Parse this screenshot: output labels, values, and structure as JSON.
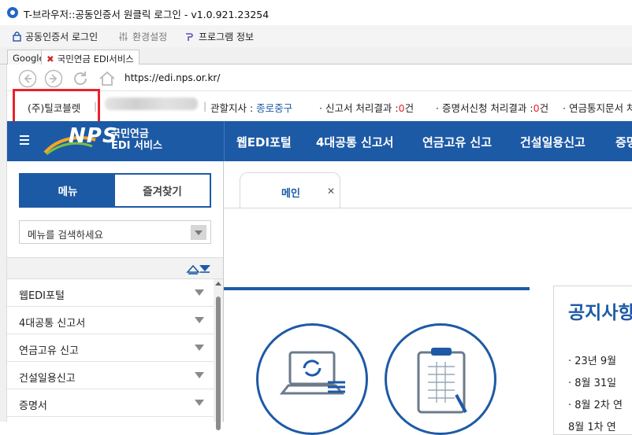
{
  "window": {
    "title": "T-브라우저::공동인증서 원클릭 로그인 - v1.0.921.23254"
  },
  "menubar": [
    {
      "label": "공동인증서 로그인",
      "icon": "lock-icon"
    },
    {
      "label": "환경설정",
      "icon": "sliders-icon"
    },
    {
      "label": "프로그램 정보",
      "icon": "program-info-icon"
    }
  ],
  "tabs": [
    {
      "label": "Google"
    },
    {
      "label": "국민연금 EDI서비스",
      "icon": "close-icon"
    }
  ],
  "address": {
    "url": "https://edi.nps.or.kr/"
  },
  "infobar": {
    "company": "(주)틸코블렛",
    "branch_label": "관할지사 :",
    "branch_value": "종로중구",
    "report_label": "· 신고서 처리결과 :",
    "report_count": "0",
    "cert_label": "· 증명서신청 처리결과 :",
    "cert_count": "0",
    "unit": "건",
    "notice_label": "· 연금통지문서 처"
  },
  "header": {
    "brand_logo": "NPS",
    "brand_line1": "국민연금",
    "brand_line2": "EDI 서비스",
    "nav": [
      "웹EDI포털",
      "4대공통 신고서",
      "연금고유 신고",
      "건설일용신고",
      "증명"
    ]
  },
  "sidebar": {
    "tabs": [
      "메뉴",
      "즐겨찾기"
    ],
    "search_placeholder": "메뉴를 검색하세요",
    "items": [
      "웹EDI포털",
      "4대공통 신고서",
      "연금고유 신고",
      "건설일용신고",
      "증명서"
    ]
  },
  "content": {
    "tab_label": "메인",
    "notice_title": "공지사항",
    "notices": [
      "· 23년 9월 ",
      "· 8월 31일 ",
      "· 8월 2차 연",
      "8월 1차 연"
    ]
  },
  "colors": {
    "brand_blue": "#1d5aa6",
    "alert_red": "#e8232b"
  }
}
